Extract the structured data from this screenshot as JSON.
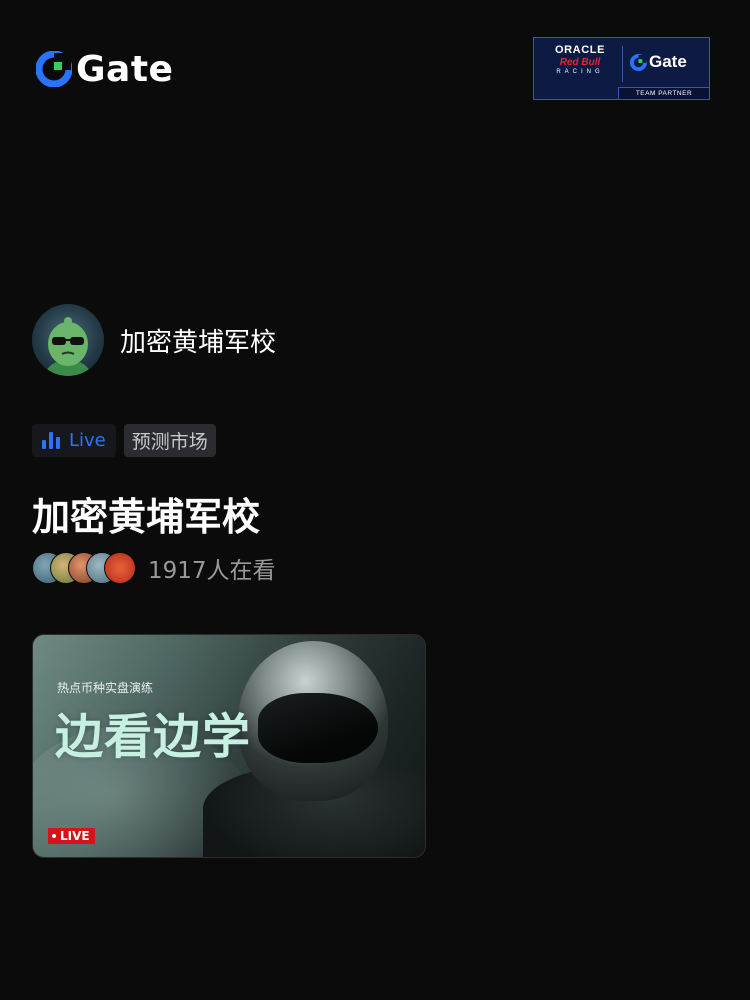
{
  "brand": {
    "logo_text": "Gate",
    "accent": "#2a73ff",
    "logo_green": "#2dd35b"
  },
  "partner_badge": {
    "line1": "ORACLE",
    "line2": "Red Bull",
    "line3": "RACING",
    "brand": "Gate",
    "footer": "TEAM PARTNER"
  },
  "host": {
    "name": "加密黄埔军校",
    "avatar_icon": "avatar-cartoon"
  },
  "tags": {
    "live_label": "Live",
    "category": "预测市场"
  },
  "stream": {
    "title": "加密黄埔军校",
    "viewers": "1917人在看"
  },
  "card": {
    "subtitle": "热点币种实盘演练",
    "headline": "边看边学",
    "live_badge": "LIVE"
  }
}
